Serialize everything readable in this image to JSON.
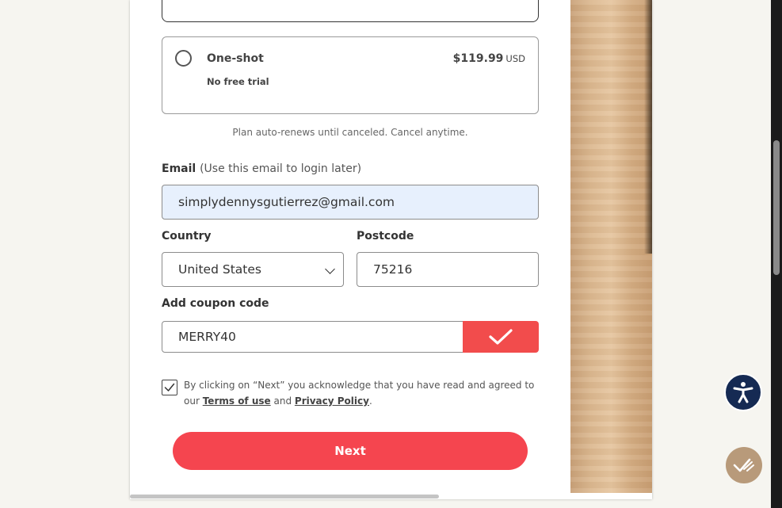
{
  "plan": {
    "name": "One-shot",
    "subtitle": "No free trial",
    "price": "$119.99",
    "currency": "USD"
  },
  "renew_note": "Plan auto-renews until canceled. Cancel anytime.",
  "email": {
    "label": "Email",
    "hint": "(Use this email to login later)",
    "value": "simplydennysgutierrez@gmail.com"
  },
  "country": {
    "label": "Country",
    "value": "United States"
  },
  "postcode": {
    "label": "Postcode",
    "value": "75216"
  },
  "coupon": {
    "label": "Add coupon code",
    "value": "MERRY40"
  },
  "terms": {
    "prefix": "By clicking on “Next” you acknowledge that you have read and agreed to our",
    "terms_link": "Terms of use",
    "and": "and",
    "privacy_link": "Privacy Policy",
    "suffix": "."
  },
  "next_label": "Next",
  "colors": {
    "accent": "#f5454f",
    "accessibility": "#152a53"
  },
  "icons": {
    "coupon_apply": "checkmark-icon",
    "terms_checkbox": "checkmark-icon",
    "accessibility": "accessibility-icon",
    "assistant": "sparkle-check-icon"
  }
}
